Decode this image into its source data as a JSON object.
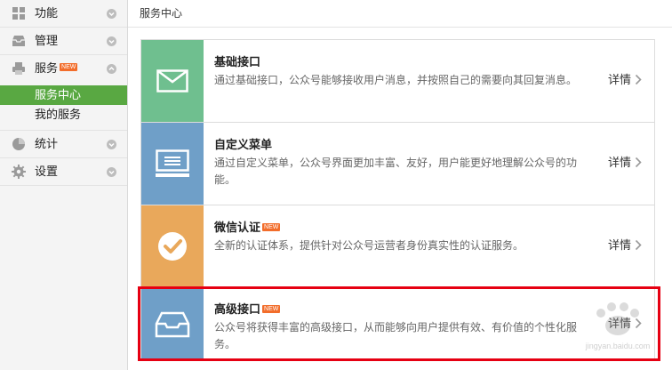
{
  "sidebar": {
    "items": [
      {
        "label": "功能",
        "icon": "grid-icon"
      },
      {
        "label": "管理",
        "icon": "inbox-icon"
      },
      {
        "label": "服务",
        "icon": "printer-icon",
        "badge": "NEW"
      },
      {
        "label": "统计",
        "icon": "pie-chart-icon"
      },
      {
        "label": "设置",
        "icon": "gear-icon"
      }
    ],
    "sub_items": [
      "服务中心",
      "我的服务"
    ]
  },
  "main": {
    "header": "服务中心",
    "cards": [
      {
        "title": "基础接口",
        "desc": "通过基础接口，公众号能够接收用户消息，并按照自己的需要向其回复消息。",
        "more": "详情",
        "color": "#6fbf8f",
        "icon": "envelope-icon"
      },
      {
        "title": "自定义菜单",
        "desc": "通过自定义菜单，公众号界面更加丰富、友好，用户能更好地理解公众号的功能。",
        "more": "详情",
        "color": "#6f9fc8",
        "icon": "menu-screen-icon"
      },
      {
        "title": "微信认证",
        "badge": "NEW",
        "desc": "全新的认证体系，提供针对公众号运营者身份真实性的认证服务。",
        "more": "详情",
        "color": "#e9a85b",
        "icon": "check-circle-icon"
      },
      {
        "title": "高级接口",
        "badge": "NEW",
        "desc": "公众号将获得丰富的高级接口，从而能够向用户提供有效、有价值的个性化服务。",
        "more": "详情",
        "color": "#6f9fc8",
        "icon": "tray-icon"
      }
    ]
  },
  "watermark": {
    "text": "jingyan.baidu.com"
  },
  "colors": {
    "active_green": "#59a842",
    "highlight_red": "#e60012",
    "badge_orange": "#f26d2b"
  }
}
